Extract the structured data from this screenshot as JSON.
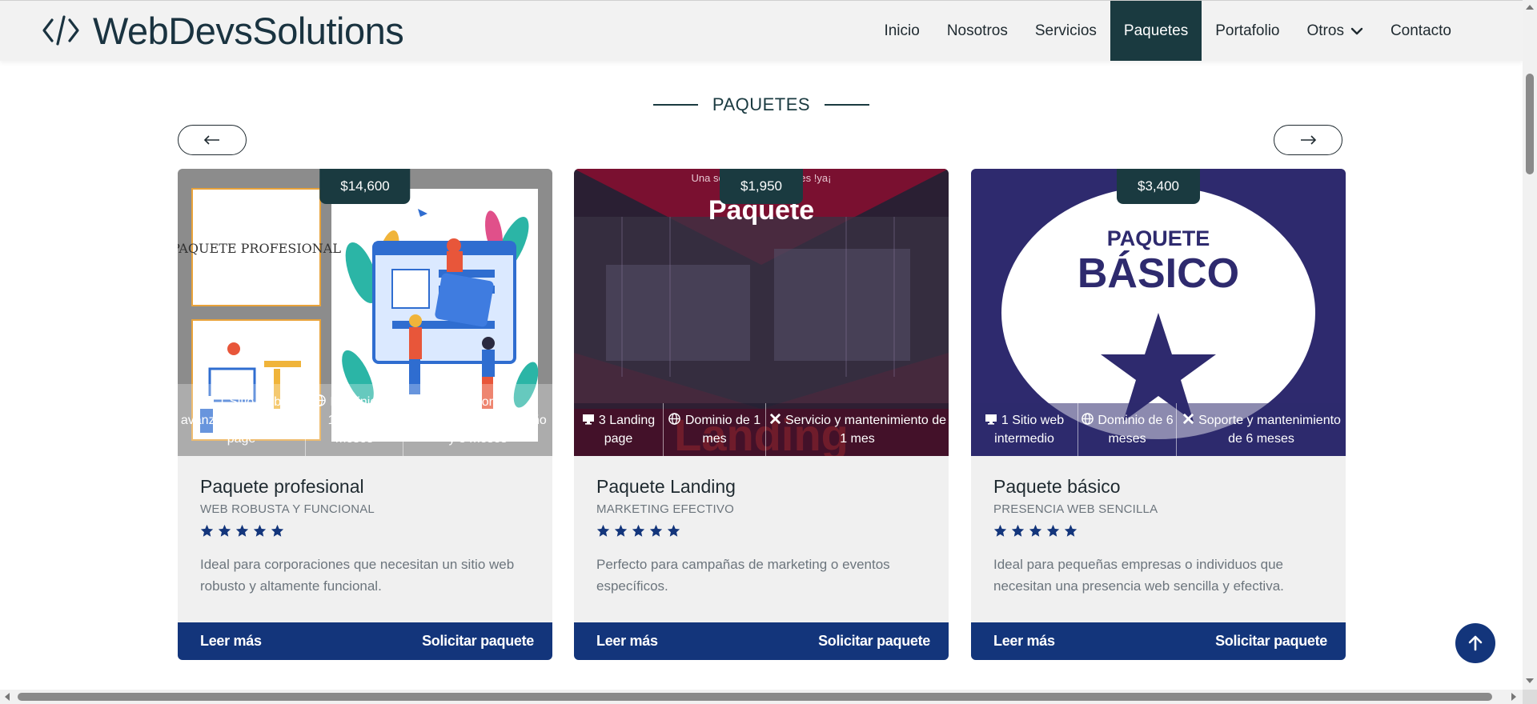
{
  "brand": {
    "name": "WebDevsSolutions"
  },
  "nav": {
    "items": [
      {
        "label": "Inicio"
      },
      {
        "label": "Nosotros"
      },
      {
        "label": "Servicios"
      },
      {
        "label": "Paquetes",
        "active": true
      },
      {
        "label": "Portafolio"
      },
      {
        "label": "Otros",
        "dropdown": true
      },
      {
        "label": "Contacto"
      }
    ]
  },
  "section": {
    "title": "PAQUETES"
  },
  "carousel": {
    "prev_icon": "arrow-left-icon",
    "next_icon": "arrow-right-icon"
  },
  "cards": [
    {
      "price": "$14,600",
      "image": {
        "heading": "PAQUETE PROFESIONAL"
      },
      "features": [
        {
          "icon": "desktop-icon",
          "text": "1 Sitio web avanzado y 1 landing page"
        },
        {
          "icon": "globe-icon",
          "text": "Dominio de 1 año y 3 meses"
        },
        {
          "icon": "tools-icon",
          "text": "Soporte y mantenimiento de 1 año y 3 meses"
        }
      ],
      "title": "Paquete profesional",
      "subtitle": "WEB ROBUSTA Y FUNCIONAL",
      "rating": 5,
      "description": "Ideal para corporaciones que necesitan un sitio web robusto y altamente funcional.",
      "read_more": "Leer más",
      "request": "Solicitar paquete"
    },
    {
      "price": "$1,950",
      "image": {
        "caption": "Una sola página ... ciones !ya¡",
        "heading": "Paquete",
        "bottom_word": "Landing"
      },
      "features": [
        {
          "icon": "desktop-icon",
          "text": "3 Landing page"
        },
        {
          "icon": "globe-icon",
          "text": "Dominio de 1 mes"
        },
        {
          "icon": "tools-icon",
          "text": "Servicio y mantenimiento de 1 mes"
        }
      ],
      "title": "Paquete Landing",
      "subtitle": "MARKETING EFECTIVO",
      "rating": 5,
      "description": "Perfecto para campañas de marketing o eventos específicos.",
      "read_more": "Leer más",
      "request": "Solicitar paquete"
    },
    {
      "price": "$3,400",
      "image": {
        "line1": "PAQUETE",
        "line2": "BÁSICO"
      },
      "features": [
        {
          "icon": "desktop-icon",
          "text": "1 Sitio web intermedio"
        },
        {
          "icon": "globe-icon",
          "text": "Dominio de 6 meses"
        },
        {
          "icon": "tools-icon",
          "text": "Soporte y mantenimiento de 6 meses"
        }
      ],
      "title": "Paquete básico",
      "subtitle": "PRESENCIA WEB SENCILLA",
      "rating": 5,
      "description": "Ideal para pequeñas empresas o individuos que necesitan una presencia web sencilla y efectiva.",
      "read_more": "Leer más",
      "request": "Solicitar paquete"
    }
  ],
  "colors": {
    "primary": "#13357b",
    "dark": "#1a3a40",
    "navbar_bg": "#f2f2f2",
    "card_bg": "#f0f0f0",
    "star": "#13357b"
  },
  "back_to_top": {
    "icon": "arrow-up-icon"
  }
}
